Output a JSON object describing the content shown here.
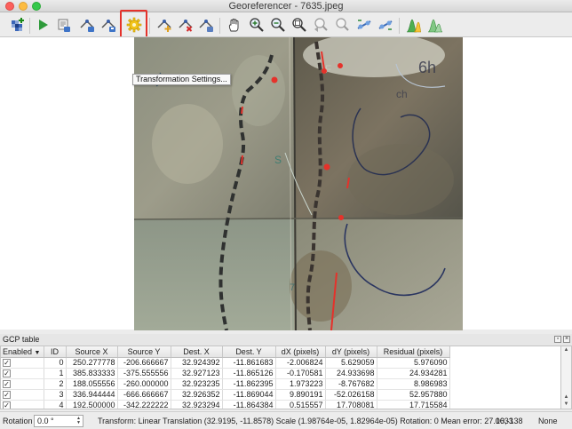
{
  "window": {
    "title": "Georeferencer - 7635.jpeg"
  },
  "toolbar": {
    "tooltip": "Transformation Settings...",
    "buttons": [
      "open-raster",
      "start-georeferencing",
      "generate-gdal-script",
      "load-gcp-points",
      "save-gcp-points",
      "transformation-settings",
      "add-point",
      "delete-point",
      "move-gcp-point",
      "pan",
      "zoom-in",
      "zoom-out",
      "zoom-to-layer",
      "zoom-last",
      "zoom-next",
      "link-georeferencer-to-qgis",
      "link-qgis-to-georeferencer",
      "full-histogram-stretch",
      "local-histogram-stretch"
    ]
  },
  "gcp_table": {
    "title": "GCP table",
    "columns": [
      "Enabled",
      "ID",
      "Source X",
      "Source Y",
      "Dest. X",
      "Dest. Y",
      "dX (pixels)",
      "dY (pixels)",
      "Residual (pixels)"
    ],
    "rows": [
      {
        "enabled": "✓",
        "id": "0",
        "source_x": "250.277778",
        "source_y": "-206.666667",
        "dest_x": "32.924392",
        "dest_y": "-11.861683",
        "dx": "-2.006824",
        "dy": "5.629059",
        "residual": "5.976090"
      },
      {
        "enabled": "✓",
        "id": "1",
        "source_x": "385.833333",
        "source_y": "-375.555556",
        "dest_x": "32.927123",
        "dest_y": "-11.865126",
        "dx": "-0.170581",
        "dy": "24.933698",
        "residual": "24.934281"
      },
      {
        "enabled": "✓",
        "id": "2",
        "source_x": "188.055556",
        "source_y": "-260.000000",
        "dest_x": "32.923235",
        "dest_y": "-11.862395",
        "dx": "1.973223",
        "dy": "-8.767682",
        "residual": "8.986983"
      },
      {
        "enabled": "✓",
        "id": "3",
        "source_x": "336.944444",
        "source_y": "-666.666667",
        "dest_x": "32.926352",
        "dest_y": "-11.869044",
        "dx": "9.890191",
        "dy": "-52.026158",
        "residual": "52.957880"
      },
      {
        "enabled": "✓",
        "id": "4",
        "source_x": "192.500000",
        "source_y": "-342.222222",
        "dest_x": "32.923294",
        "dest_y": "-11.864384",
        "dx": "0.515557",
        "dy": "17.708081",
        "residual": "17.715584"
      }
    ]
  },
  "statusbar": {
    "rotation_label": "Rotation",
    "rotation_value": "0.0 °",
    "transform": "Transform: Linear Translation (32.9195, -11.8578) Scale (1.98764e-05, 1.82964e-05) Rotation: 0 Mean error: 27.0633",
    "coords": "10,-138",
    "crs": "None"
  },
  "colors": {
    "highlight": "#e5322b",
    "gcp_marker": "#e5322b"
  }
}
